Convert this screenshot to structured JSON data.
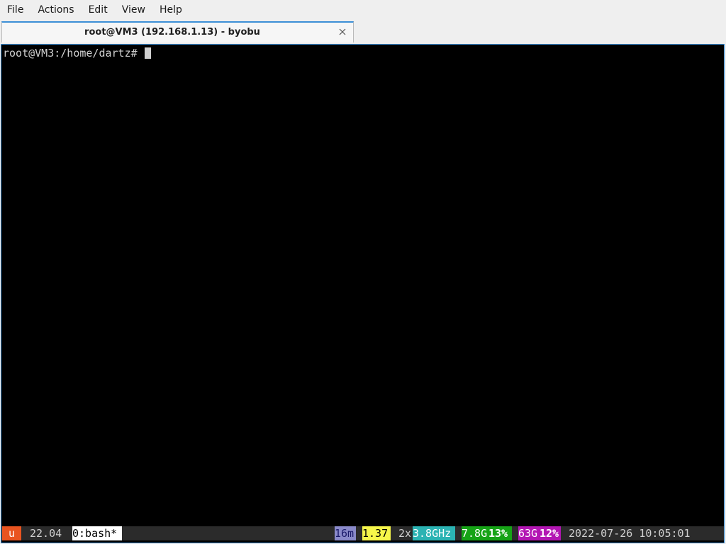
{
  "menubar": {
    "items": [
      "File",
      "Actions",
      "Edit",
      "View",
      "Help"
    ]
  },
  "tab": {
    "title": "root@VM3 (192.168.1.13) - byobu",
    "close_icon": "close-icon"
  },
  "terminal": {
    "prompt": "root@VM3:/home/dartz#",
    "cursor": "block-cursor"
  },
  "statusbar": {
    "logo": "u",
    "release": "22.04",
    "window": "0:bash*",
    "uptime": "16m",
    "load": "1.37",
    "cpu_count": "2x",
    "cpu_freq": "3.8GHz",
    "mem_total": "7.8G",
    "mem_pct": "13%",
    "disk_total": "63G",
    "disk_pct": "12%",
    "datetime": "2022-07-26 10:05:01"
  },
  "colors": {
    "accent": "#3d8fd6",
    "logo_bg": "#e95420",
    "uptime_bg": "#8a8aca",
    "load_bg": "#f6f64a",
    "cpu_freq_bg": "#2bb3b3",
    "mem_bg": "#16a316",
    "disk_bg": "#b316b3"
  }
}
